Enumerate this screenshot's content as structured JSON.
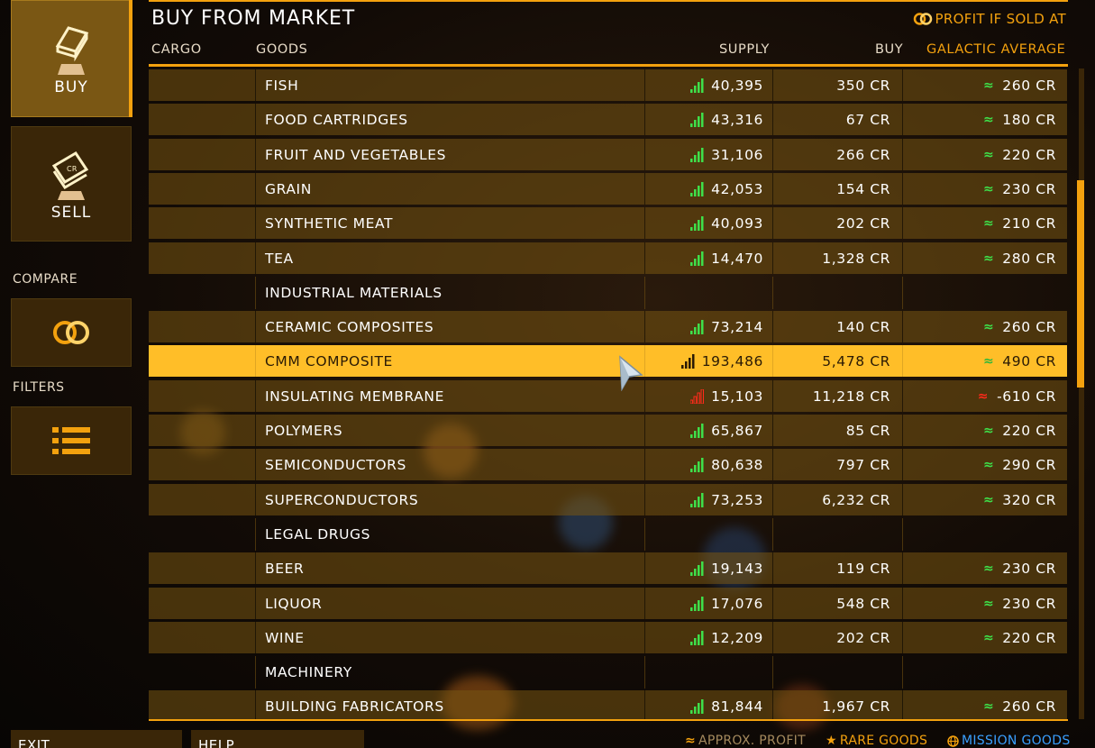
{
  "sidebar": {
    "buy_label": "BUY",
    "sell_label": "SELL",
    "compare_heading": "COMPARE",
    "filters_heading": "FILTERS"
  },
  "header": {
    "title": "BUY FROM MARKET",
    "profit_if_sold_at": "PROFIT IF SOLD AT"
  },
  "columns": {
    "cargo": "CARGO",
    "goods": "GOODS",
    "supply": "SUPPLY",
    "buy": "BUY",
    "galactic_average": "GALACTIC AVERAGE"
  },
  "rows": [
    {
      "type": "item",
      "goods": "FISH",
      "supply": "40,395",
      "supply_level": "high",
      "buy": "350 CR",
      "profit_sign": "pos",
      "profit": "260 CR"
    },
    {
      "type": "item",
      "goods": "FOOD CARTRIDGES",
      "supply": "43,316",
      "supply_level": "high",
      "buy": "67 CR",
      "profit_sign": "pos",
      "profit": "180 CR"
    },
    {
      "type": "item",
      "goods": "FRUIT AND VEGETABLES",
      "supply": "31,106",
      "supply_level": "high",
      "buy": "266 CR",
      "profit_sign": "pos",
      "profit": "220 CR"
    },
    {
      "type": "item",
      "goods": "GRAIN",
      "supply": "42,053",
      "supply_level": "high",
      "buy": "154 CR",
      "profit_sign": "pos",
      "profit": "230 CR"
    },
    {
      "type": "item",
      "goods": "SYNTHETIC MEAT",
      "supply": "40,093",
      "supply_level": "high",
      "buy": "202 CR",
      "profit_sign": "pos",
      "profit": "210 CR"
    },
    {
      "type": "item",
      "goods": "TEA",
      "supply": "14,470",
      "supply_level": "high",
      "buy": "1,328 CR",
      "profit_sign": "pos",
      "profit": "280 CR"
    },
    {
      "type": "category",
      "goods": "INDUSTRIAL MATERIALS"
    },
    {
      "type": "item",
      "goods": "CERAMIC COMPOSITES",
      "supply": "73,214",
      "supply_level": "high",
      "buy": "140 CR",
      "profit_sign": "pos",
      "profit": "260 CR"
    },
    {
      "type": "item",
      "goods": "CMM COMPOSITE",
      "supply": "193,486",
      "supply_level": "high",
      "buy": "5,478 CR",
      "profit_sign": "pos",
      "profit": "490 CR",
      "selected": true
    },
    {
      "type": "item",
      "goods": "INSULATING MEMBRANE",
      "supply": "15,103",
      "supply_level": "low",
      "buy": "11,218 CR",
      "profit_sign": "neg",
      "profit": "-610 CR"
    },
    {
      "type": "item",
      "goods": "POLYMERS",
      "supply": "65,867",
      "supply_level": "high",
      "buy": "85 CR",
      "profit_sign": "pos",
      "profit": "220 CR"
    },
    {
      "type": "item",
      "goods": "SEMICONDUCTORS",
      "supply": "80,638",
      "supply_level": "high",
      "buy": "797 CR",
      "profit_sign": "pos",
      "profit": "290 CR"
    },
    {
      "type": "item",
      "goods": "SUPERCONDUCTORS",
      "supply": "73,253",
      "supply_level": "high",
      "buy": "6,232 CR",
      "profit_sign": "pos",
      "profit": "320 CR"
    },
    {
      "type": "category",
      "goods": "LEGAL DRUGS"
    },
    {
      "type": "item",
      "goods": "BEER",
      "supply": "19,143",
      "supply_level": "high",
      "buy": "119 CR",
      "profit_sign": "pos",
      "profit": "230 CR"
    },
    {
      "type": "item",
      "goods": "LIQUOR",
      "supply": "17,076",
      "supply_level": "high",
      "buy": "548 CR",
      "profit_sign": "pos",
      "profit": "230 CR"
    },
    {
      "type": "item",
      "goods": "WINE",
      "supply": "12,209",
      "supply_level": "high",
      "buy": "202 CR",
      "profit_sign": "pos",
      "profit": "220 CR"
    },
    {
      "type": "category",
      "goods": "MACHINERY"
    },
    {
      "type": "item",
      "goods": "BUILDING FABRICATORS",
      "supply": "81,844",
      "supply_level": "high",
      "buy": "1,967 CR",
      "profit_sign": "pos",
      "profit": "260 CR"
    }
  ],
  "footer": {
    "exit_label": "EXIT",
    "help_label": "HELP",
    "legend_approx": "APPROX. PROFIT",
    "legend_rare": "RARE GOODS",
    "legend_mission": "MISSION GOODS"
  },
  "colors": {
    "accent": "#f3a10e",
    "row_bg": "#6b4a10",
    "selected_row": "#ffbe28",
    "profit_pos": "#3ee04a",
    "profit_neg": "#ff2a1a",
    "mission": "#3aa0ff"
  },
  "icons": {
    "buy": "gold-bar-icon",
    "sell": "credit-notes-icon",
    "compare": "rings-icon",
    "filters": "list-icon",
    "supply": "signal-bars-icon",
    "profit": "approx-icon",
    "rare": "star-icon",
    "mission": "globe-icon"
  }
}
